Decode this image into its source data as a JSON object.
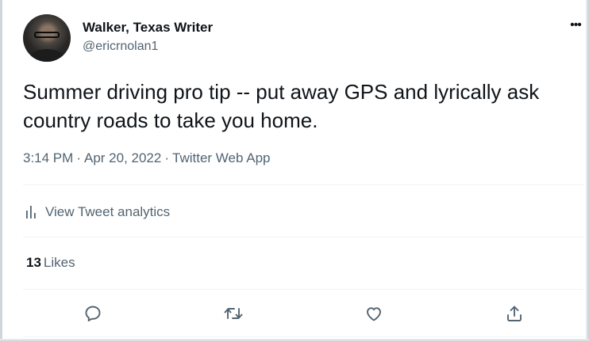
{
  "author": {
    "name": "Walker, Texas Writer",
    "handle": "@ericrnolan1"
  },
  "menu": {
    "icon": "more-horizontal-icon",
    "glyph": "•••"
  },
  "tweet": {
    "text": "Summer driving pro tip -- put away GPS and lyrically ask country roads to take you home.",
    "time": "3:14 PM",
    "date": "Apr 20, 2022",
    "source": "Twitter Web App",
    "separator": "·"
  },
  "analytics": {
    "icon": "bar-chart-icon",
    "label": "View Tweet analytics"
  },
  "stats": {
    "likes_count": "13",
    "likes_label": "Likes"
  },
  "actions": [
    {
      "name": "reply",
      "icon": "reply-icon"
    },
    {
      "name": "retweet",
      "icon": "retweet-icon"
    },
    {
      "name": "like",
      "icon": "heart-icon"
    },
    {
      "name": "share",
      "icon": "share-icon"
    }
  ],
  "colors": {
    "text_primary": "#0f1419",
    "text_secondary": "#536471",
    "divider": "#eff3f4"
  }
}
